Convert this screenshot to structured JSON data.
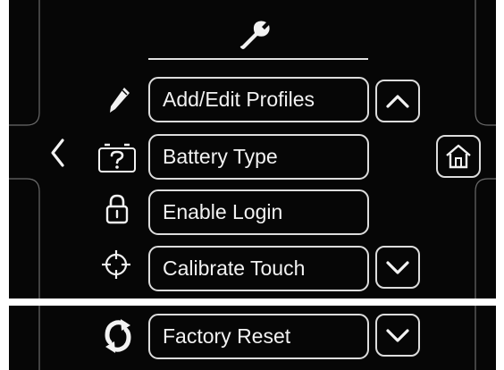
{
  "header": {
    "icon": "wrench-icon"
  },
  "menu": {
    "items": [
      {
        "label": "Add/Edit Profiles",
        "icon": "pencil-icon"
      },
      {
        "label": "Battery Type",
        "icon": "battery-question-icon"
      },
      {
        "label": "Enable Login",
        "icon": "padlock-icon"
      },
      {
        "label": "Calibrate Touch",
        "icon": "crosshair-icon"
      }
    ]
  },
  "lower": {
    "items": [
      {
        "label": "Factory Reset",
        "icon": "refresh-icon"
      }
    ]
  },
  "nav": {
    "back_icon": "chevron-left-icon",
    "home_icon": "home-icon",
    "scroll_up_icon": "chevron-up-icon",
    "scroll_down_icon": "chevron-down-icon"
  },
  "colors": {
    "background": "#060606",
    "foreground": "#f2f2f2",
    "border": "#dcdcdc",
    "frame_lines": "#6a6a6a"
  }
}
